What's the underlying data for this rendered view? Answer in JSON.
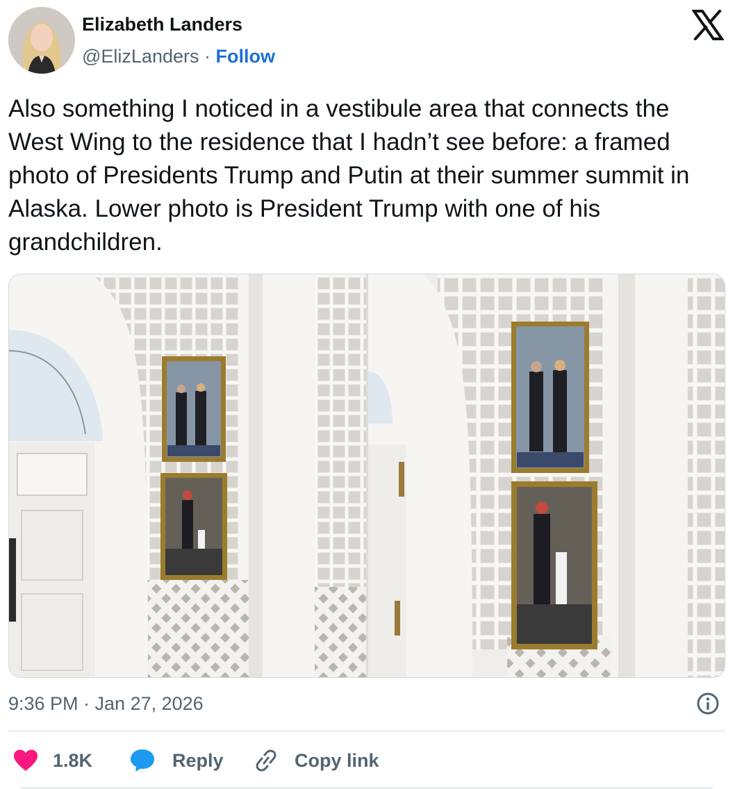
{
  "author": {
    "name": "Elizabeth Landers",
    "handle": "@ElizLanders",
    "separator": " · ",
    "follow_label": "Follow"
  },
  "tweet": {
    "text": "Also something I noticed in a vestibule area that connects the West Wing to the residence that I hadn’t see before: a framed photo of Presidents Trump and Putin at their summer summit in Alaska. Lower photo is President Trump with one of his grandchildren.",
    "timestamp": "9:36 PM · Jan 27, 2026"
  },
  "actions": {
    "like_count": "1.8K",
    "reply_label": "Reply",
    "copy_link_label": "Copy link"
  },
  "icons": {
    "brand": "x-logo-icon",
    "info": "info-icon",
    "like": "heart-icon",
    "reply": "speech-bubble-icon",
    "copy": "link-icon"
  },
  "colors": {
    "link_blue": "#1d6fd6",
    "heart": "#f91880",
    "reply_bubble": "#1d9bf0",
    "muted_text": "#536471"
  }
}
